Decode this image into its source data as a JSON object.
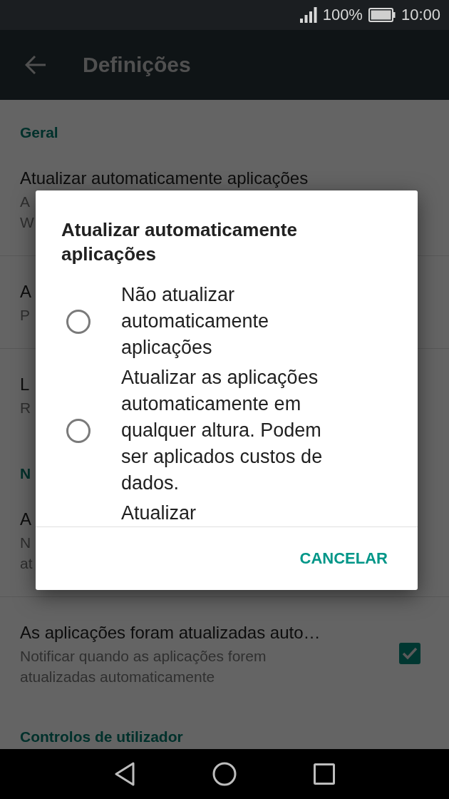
{
  "status_bar": {
    "battery": "100%",
    "time": "10:00"
  },
  "app_bar": {
    "title": "Definições"
  },
  "sections": [
    {
      "header": "Geral",
      "rows": [
        {
          "title": "Atualizar automaticamente aplicações",
          "subtitle": [
            "A",
            "W"
          ]
        },
        {
          "title": "A",
          "subtitle": [
            "P"
          ]
        },
        {
          "title": "L",
          "subtitle": [
            "R"
          ]
        }
      ]
    },
    {
      "header": "N",
      "rows": [
        {
          "title": "A",
          "subtitle": [
            "N",
            "at"
          ]
        },
        {
          "title": "As aplicações foram atualizadas auto…",
          "subtitle": [
            "Notificar quando as aplicações forem",
            "atualizadas automaticamente"
          ],
          "checked": true
        }
      ]
    },
    {
      "header": "Controlos de utilizador"
    }
  ],
  "dialog": {
    "title": "Atualizar automaticamente aplicações",
    "options": [
      {
        "label": "Não atualizar automaticamente aplicações",
        "selected": false
      },
      {
        "label": "Atualizar as aplicações automaticamente em qualquer altura. Podem ser aplicados custos de dados.",
        "selected": false
      }
    ],
    "partial_option": "Atualizar",
    "buttons": [
      "CANCELAR"
    ]
  }
}
